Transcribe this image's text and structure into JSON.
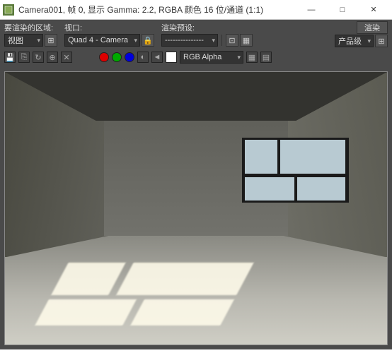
{
  "titlebar": {
    "text": "Camera001, 帧 0, 显示 Gamma: 2.2, RGBA 颜色 16 位/通道 (1:1)"
  },
  "window_controls": {
    "minimize": "—",
    "maximize": "□",
    "close": "✕"
  },
  "toolbar": {
    "area_label": "要渲染的区域:",
    "area_value": "视图",
    "viewport_label": "视口:",
    "viewport_value": "Quad 4 - Camera",
    "preset_label": "渲染预设:",
    "preset_value": "---------------",
    "render_button": "渲染",
    "quality_value": "产品级",
    "channel_value": "RGB Alpha"
  },
  "icons": {
    "lock": "🔒",
    "tool1": "⊞",
    "tool2": "⊡",
    "save": "💾",
    "copy": "⎘",
    "mono": "◐",
    "slider": "◄",
    "grid1": "▦",
    "grid2": "▤",
    "a": "A",
    "b": "↻",
    "c": "⊕",
    "d": "◉",
    "e": "✕"
  }
}
